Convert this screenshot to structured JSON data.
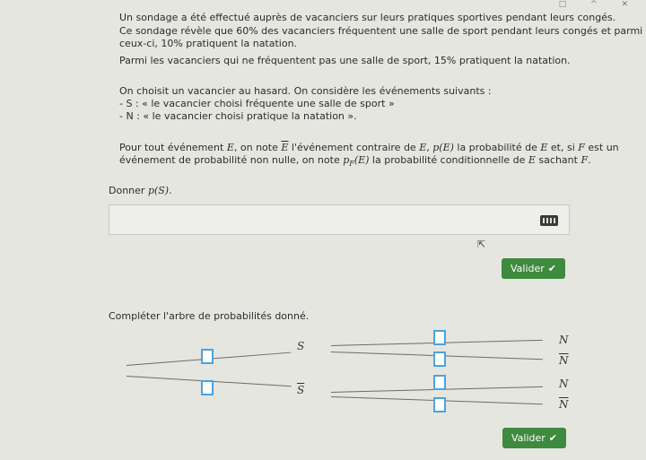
{
  "problem": {
    "p1": "Un sondage a été effectué auprès de vacanciers sur leurs pratiques sportives pendant leurs congés.",
    "p2": "Ce sondage révèle que 60% des vacanciers fréquentent une salle de sport pendant leurs congés et parmi",
    "p3": "ceux-ci, 10% pratiquent la natation.",
    "p4": "Parmi les vacanciers qui ne fréquentent pas une salle de sport, 15% pratiquent la natation.",
    "p5": "On choisit un vacancier au hasard. On considère les événements suivants :",
    "p6": "- S : « le vacancier choisi fréquente une salle de sport »",
    "p7": "- N : « le vacancier choisi pratique la natation ».",
    "def_a": "Pour tout événement ",
    "E": "E",
    "def_b": ", on note ",
    "def_c": " l'événement contraire de ",
    "def_d": ", ",
    "pE": "p(E)",
    "def_e": " la probabilité de ",
    "def_f": " et, si ",
    "F": "F",
    "def_g": " est un",
    "def2_a": "événement de probabilité non nulle, on note ",
    "pFE": "p",
    "pFE_sub": "F",
    "pFE_arg": "(E)",
    "def2_b": " la probabilité conditionnelle de ",
    "def2_c": " sachant ",
    "def2_d": "."
  },
  "question1": {
    "prefix": "Donner ",
    "expr": "p(S)",
    "suffix": "."
  },
  "question2": {
    "text": "Compléter l'arbre de probabilités donné."
  },
  "answer_box": {
    "value": "",
    "keyboard_icon": "keyboard-icon"
  },
  "buttons": {
    "validate": "Valider",
    "check": "✔"
  },
  "tree": {
    "S": "S",
    "S_bar": "S",
    "N": "N",
    "N_bar": "N"
  },
  "window_controls": "□ ^ ✕"
}
